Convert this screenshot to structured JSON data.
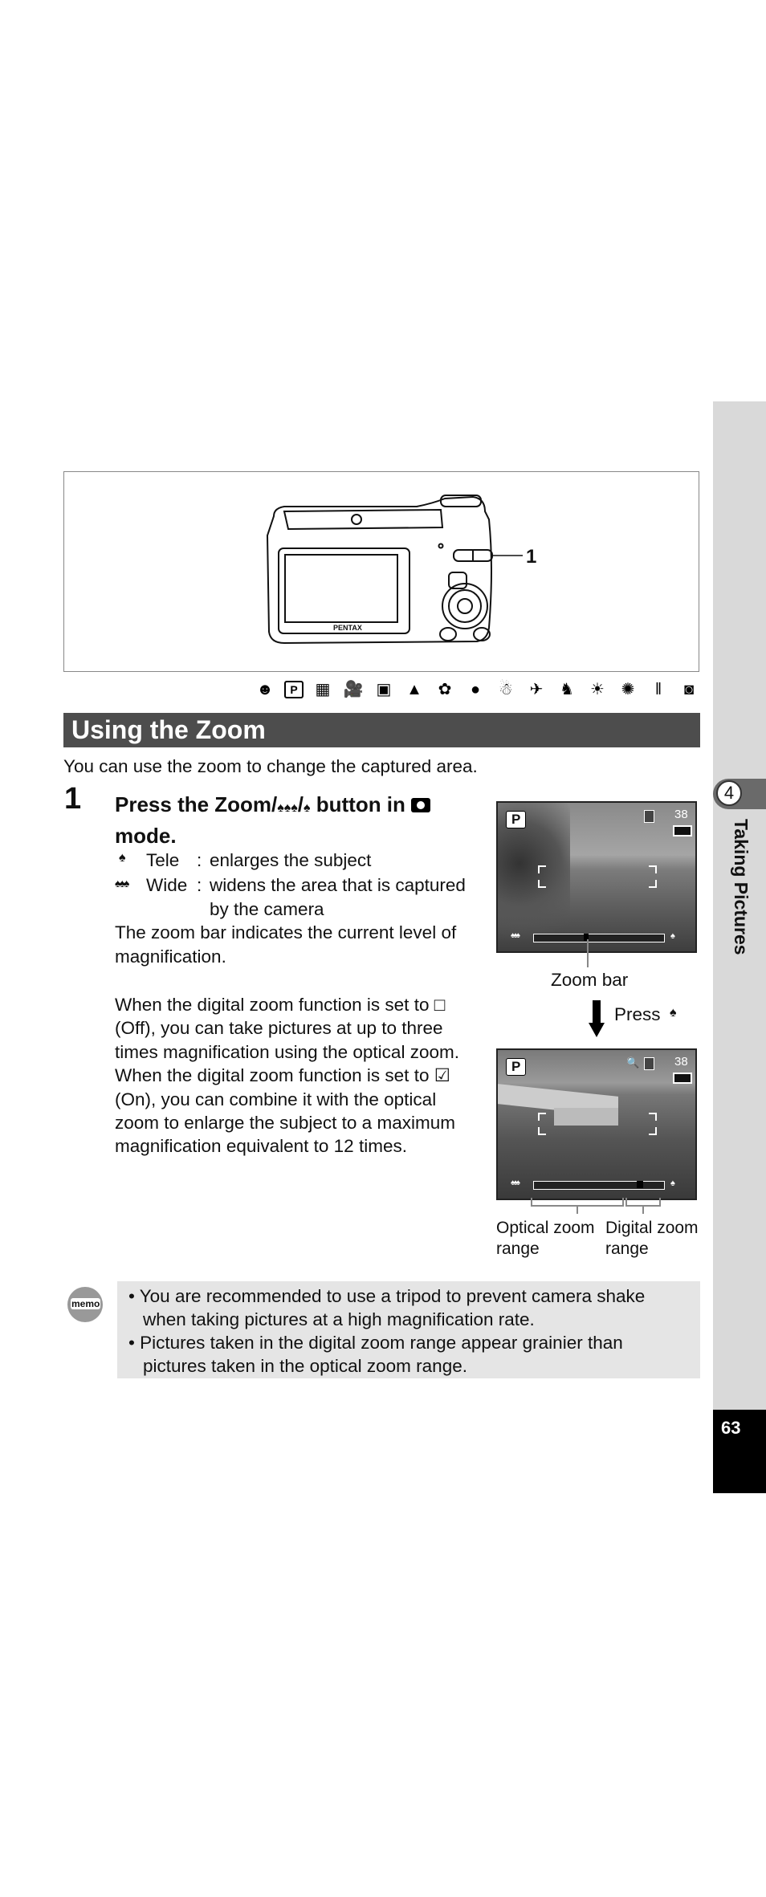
{
  "figure": {
    "callout_label": "1",
    "brand": "PENTAX"
  },
  "mode_icons": [
    "smile-icon",
    "p-mode-icon",
    "night-scene-icon",
    "movie-icon",
    "frame-heart-icon",
    "landscape-icon",
    "flower-icon",
    "portrait-icon",
    "snow-icon",
    "sport-icon",
    "pet-icon",
    "sunset-icon",
    "fireworks-icon",
    "food-icon",
    "digital-sr-icon"
  ],
  "section": {
    "title": "Using the Zoom",
    "intro": "You can use the zoom to change the captured area."
  },
  "step": {
    "number": "1",
    "title_line1": "Press the Zoom/",
    "title_wide_glyph": "♠♠♠",
    "title_slash": "/",
    "title_tele_glyph": "♠",
    "title_mid": " button in ",
    "title_line2": "mode.",
    "tele_label": "Tele",
    "tele_desc": "enlarges the subject",
    "wide_label": "Wide",
    "wide_desc_1": "widens the area that is captured",
    "wide_desc_2": "by the camera",
    "colon": ":",
    "zoom_bar_1": "The zoom bar indicates the current level of",
    "zoom_bar_2": "magnification.",
    "digital_lines": [
      "When the digital zoom function is set to □",
      "(Off), you can take pictures at up to three",
      "times magnification using the optical zoom.",
      "When the digital zoom function is set to ☑",
      "(On), you can combine it with the optical",
      "zoom to enlarge the subject to a maximum",
      "magnification equivalent to 12 times."
    ]
  },
  "screens": {
    "mode_badge": "P",
    "shots_remaining": "38",
    "zoom_bar_label": "Zoom bar",
    "press_label": "Press",
    "optical_label_1": "Optical zoom",
    "optical_label_2": "range",
    "digital_label_1": "Digital zoom",
    "digital_label_2": "range"
  },
  "memo": {
    "icon_text": "memo",
    "items": [
      [
        "• You are recommended to use a tripod to prevent camera shake",
        "when taking pictures at a high magnification rate."
      ],
      [
        "• Pictures taken in the digital zoom range appear grainier than",
        "pictures taken in the optical zoom range."
      ]
    ]
  },
  "sidebar": {
    "chapter_number": "4",
    "chapter_title": "Taking Pictures",
    "page_number": "63"
  },
  "colors": {
    "heading_bg": "#4d4d4d",
    "sidebar_bg": "#d9d9d9",
    "memo_bg": "#e5e5e5",
    "page_box": "#000000"
  }
}
